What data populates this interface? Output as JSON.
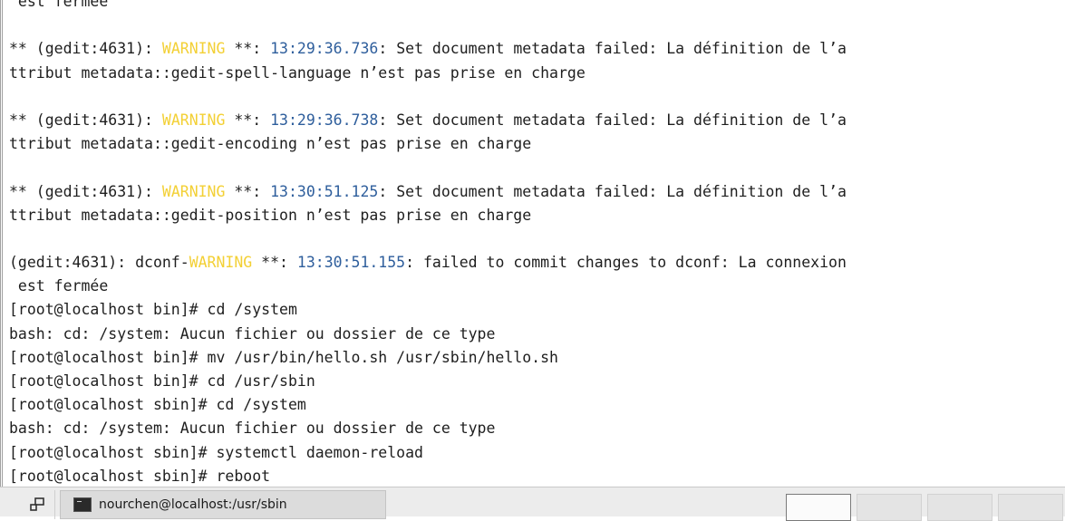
{
  "terminal": {
    "lines": [
      [
        {
          "t": " est fermée",
          "c": ""
        }
      ],
      [
        {
          "t": "",
          "c": ""
        }
      ],
      [
        {
          "t": "** (gedit:4631): ",
          "c": ""
        },
        {
          "t": "WARNING",
          "c": "warn"
        },
        {
          "t": " **: ",
          "c": ""
        },
        {
          "t": "13:29:36.736",
          "c": "time"
        },
        {
          "t": ": Set document metadata failed: La définition de l’a",
          "c": ""
        }
      ],
      [
        {
          "t": "ttribut metadata::gedit-spell-language n’est pas prise en charge",
          "c": ""
        }
      ],
      [
        {
          "t": "",
          "c": ""
        }
      ],
      [
        {
          "t": "** (gedit:4631): ",
          "c": ""
        },
        {
          "t": "WARNING",
          "c": "warn"
        },
        {
          "t": " **: ",
          "c": ""
        },
        {
          "t": "13:29:36.738",
          "c": "time"
        },
        {
          "t": ": Set document metadata failed: La définition de l’a",
          "c": ""
        }
      ],
      [
        {
          "t": "ttribut metadata::gedit-encoding n’est pas prise en charge",
          "c": ""
        }
      ],
      [
        {
          "t": "",
          "c": ""
        }
      ],
      [
        {
          "t": "** (gedit:4631): ",
          "c": ""
        },
        {
          "t": "WARNING",
          "c": "warn"
        },
        {
          "t": " **: ",
          "c": ""
        },
        {
          "t": "13:30:51.125",
          "c": "time"
        },
        {
          "t": ": Set document metadata failed: La définition de l’a",
          "c": ""
        }
      ],
      [
        {
          "t": "ttribut metadata::gedit-position n’est pas prise en charge",
          "c": ""
        }
      ],
      [
        {
          "t": "",
          "c": ""
        }
      ],
      [
        {
          "t": "(gedit:4631): dconf-",
          "c": ""
        },
        {
          "t": "WARNING",
          "c": "warn"
        },
        {
          "t": " **: ",
          "c": ""
        },
        {
          "t": "13:30:51.155",
          "c": "time"
        },
        {
          "t": ": failed to commit changes to dconf: La connexion",
          "c": ""
        }
      ],
      [
        {
          "t": " est fermée",
          "c": ""
        }
      ],
      [
        {
          "t": "[root@localhost bin]# cd /system",
          "c": ""
        }
      ],
      [
        {
          "t": "bash: cd: /system: Aucun fichier ou dossier de ce type",
          "c": ""
        }
      ],
      [
        {
          "t": "[root@localhost bin]# mv /usr/bin/hello.sh /usr/sbin/hello.sh",
          "c": ""
        }
      ],
      [
        {
          "t": "[root@localhost bin]# cd /usr/sbin",
          "c": ""
        }
      ],
      [
        {
          "t": "[root@localhost sbin]# cd /system",
          "c": ""
        }
      ],
      [
        {
          "t": "bash: cd: /system: Aucun fichier ou dossier de ce type",
          "c": ""
        }
      ],
      [
        {
          "t": "[root@localhost sbin]# systemctl daemon-reload",
          "c": ""
        }
      ],
      [
        {
          "t": "[root@localhost sbin]# reboot",
          "c": ""
        }
      ]
    ]
  },
  "colors": {
    "warning": "#f3d035",
    "timestamp": "#2e5e9c",
    "text": "#1e1e1e"
  },
  "taskbar": {
    "show_desktop_icon": "show-desktop-icon",
    "task_icon": "terminal-icon",
    "task_label": "nourchen@localhost:/usr/sbin",
    "workspaces": [
      {
        "active": true
      },
      {
        "active": false
      },
      {
        "active": false
      },
      {
        "active": false
      }
    ]
  }
}
